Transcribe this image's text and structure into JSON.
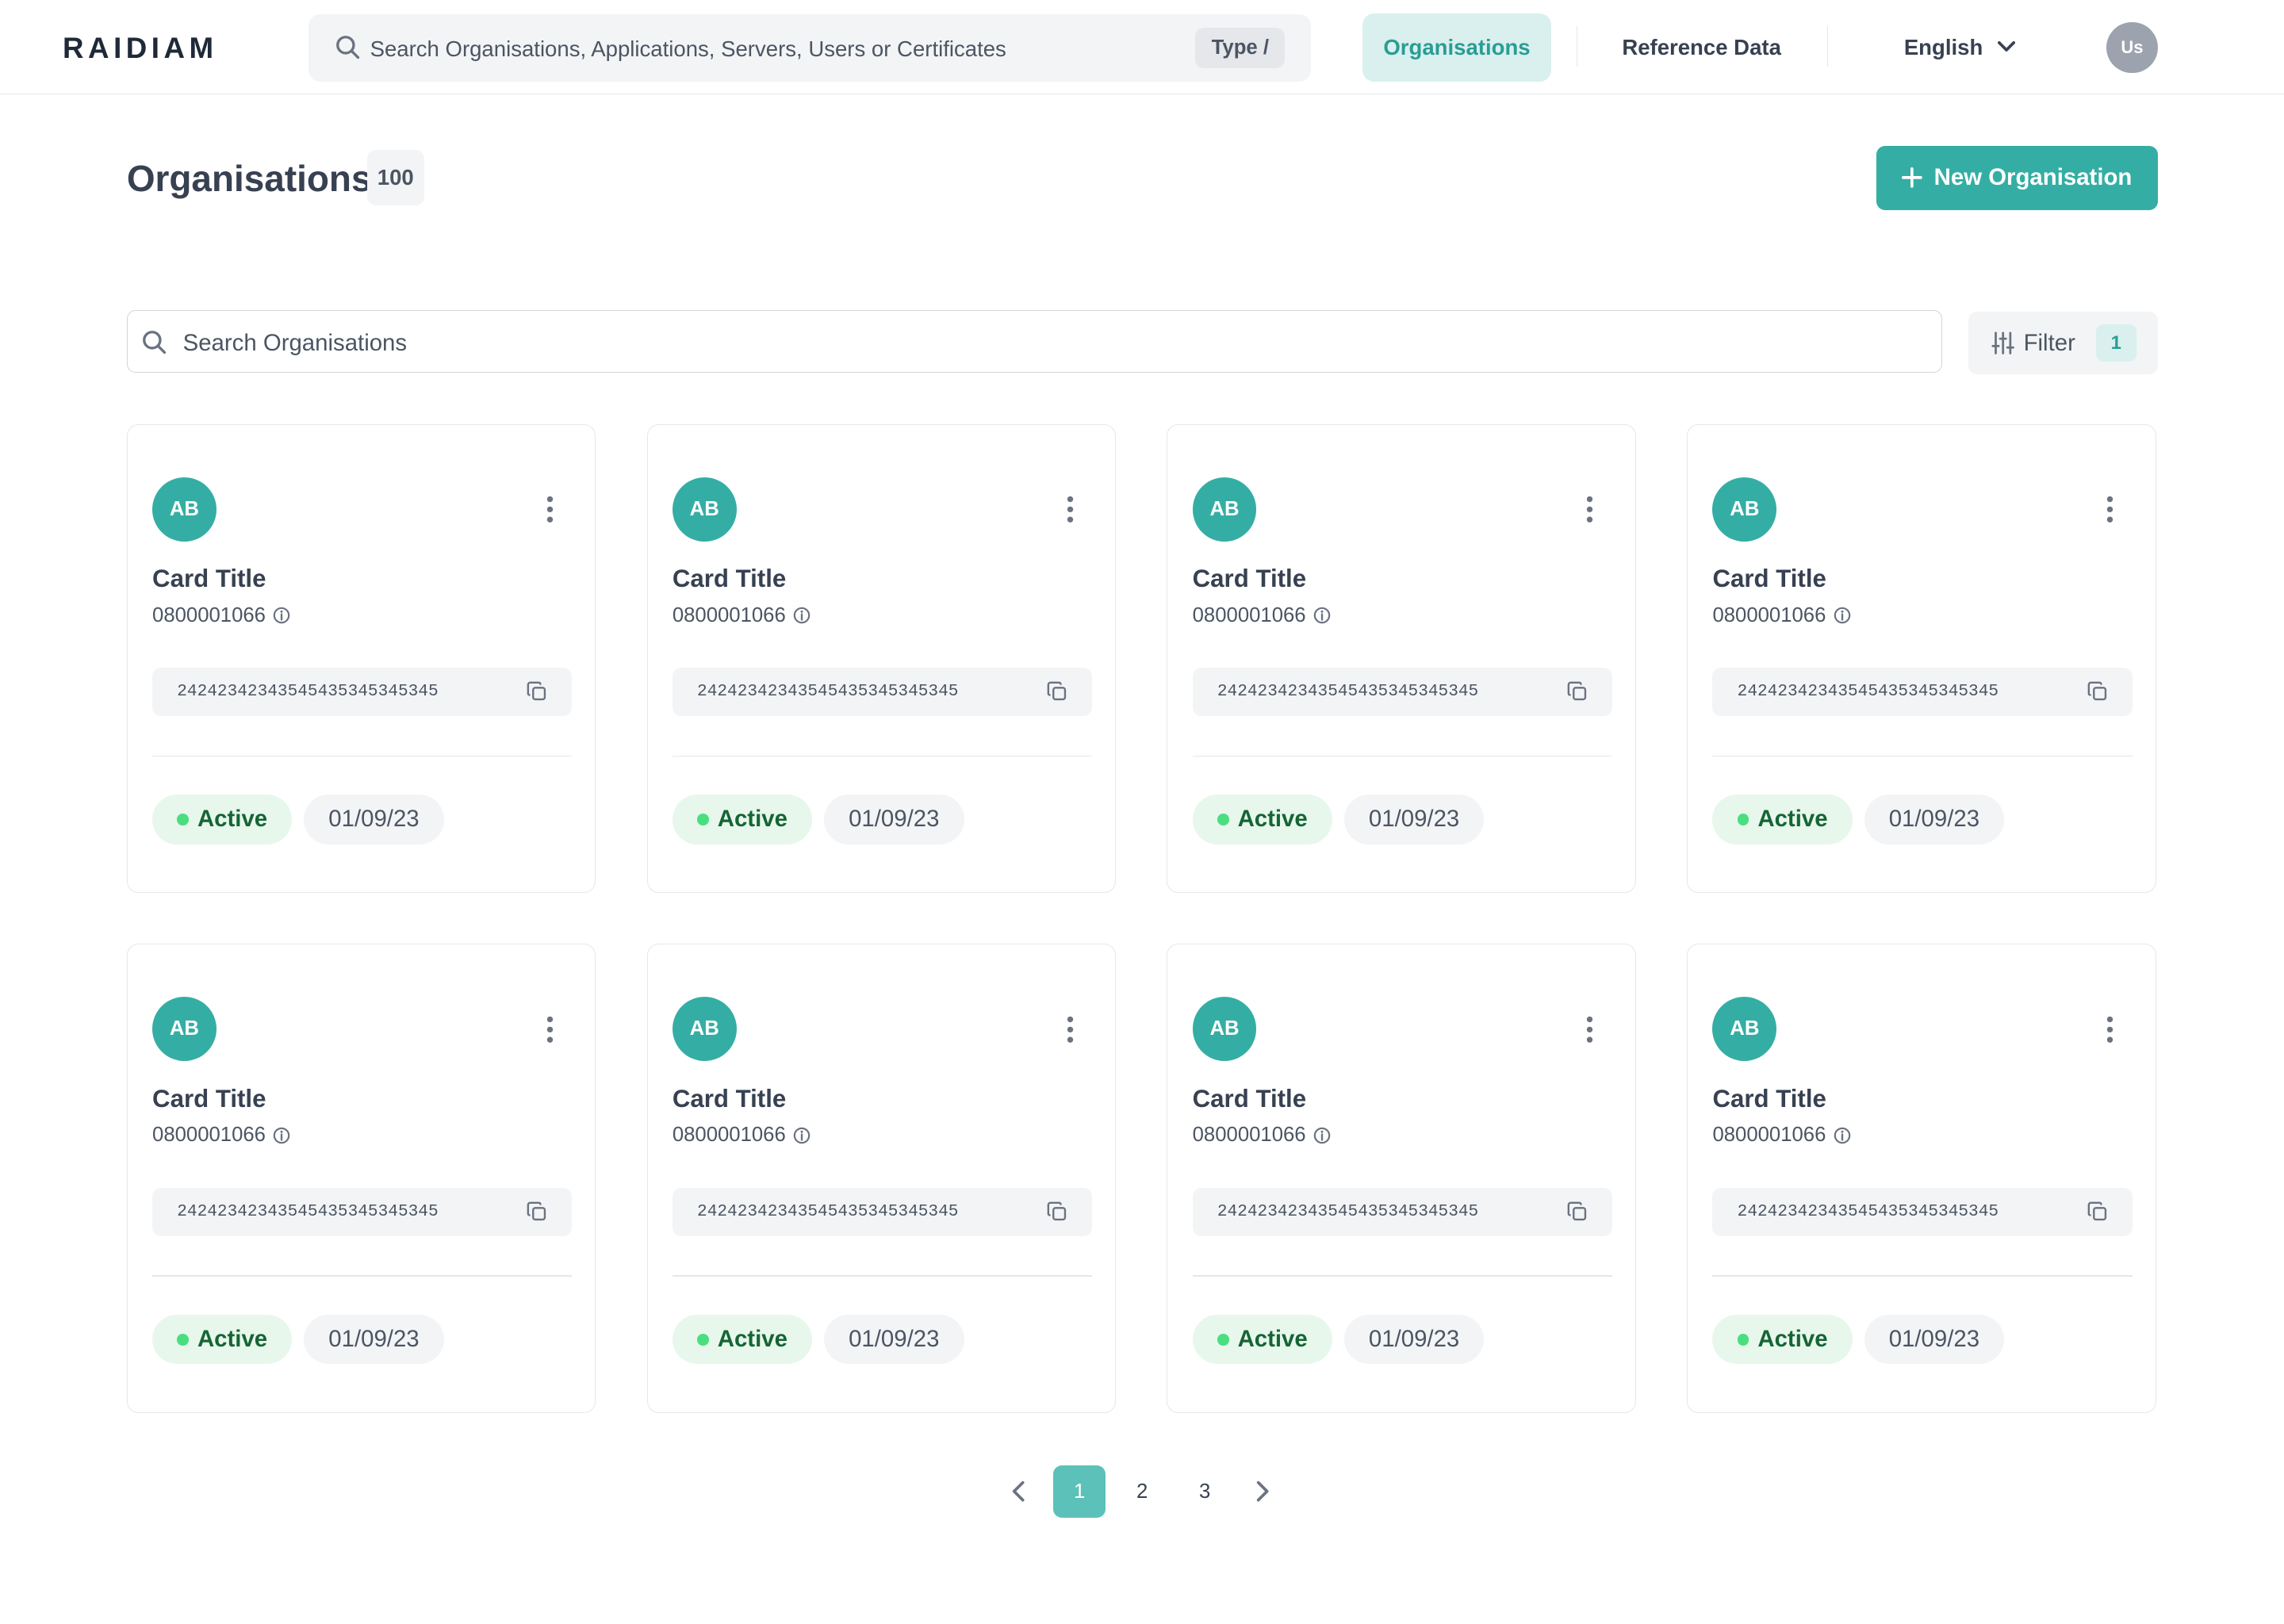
{
  "header": {
    "logo_text": "RAIDIAM",
    "search_placeholder": "Search Organisations, Applications, Servers, Users or Certificates",
    "search_shortcut": "Type /",
    "nav_organisations": "Organisations",
    "nav_reference_data": "Reference Data",
    "language": "English",
    "user_initials": "Us"
  },
  "page": {
    "title": "Organisations",
    "count": "100",
    "new_button": "New Organisation",
    "search_placeholder": "Search Organisations",
    "filter_label": "Filter",
    "filter_count": "1"
  },
  "cards": [
    {
      "initials": "AB",
      "title": "Card Title",
      "id": "0800001066",
      "code": "24242342343545435345345345",
      "status": "Active",
      "date": "01/09/23"
    },
    {
      "initials": "AB",
      "title": "Card Title",
      "id": "0800001066",
      "code": "24242342343545435345345345",
      "status": "Active",
      "date": "01/09/23"
    },
    {
      "initials": "AB",
      "title": "Card Title",
      "id": "0800001066",
      "code": "24242342343545435345345345",
      "status": "Active",
      "date": "01/09/23"
    },
    {
      "initials": "AB",
      "title": "Card Title",
      "id": "0800001066",
      "code": "24242342343545435345345345",
      "status": "Active",
      "date": "01/09/23"
    },
    {
      "initials": "AB",
      "title": "Card Title",
      "id": "0800001066",
      "code": "24242342343545435345345345",
      "status": "Active",
      "date": "01/09/23"
    },
    {
      "initials": "AB",
      "title": "Card Title",
      "id": "0800001066",
      "code": "24242342343545435345345345",
      "status": "Active",
      "date": "01/09/23"
    },
    {
      "initials": "AB",
      "title": "Card Title",
      "id": "0800001066",
      "code": "24242342343545435345345345",
      "status": "Active",
      "date": "01/09/23"
    },
    {
      "initials": "AB",
      "title": "Card Title",
      "id": "0800001066",
      "code": "24242342343545435345345345",
      "status": "Active",
      "date": "01/09/23"
    }
  ],
  "pagination": {
    "pages": [
      "1",
      "2",
      "3"
    ],
    "current": "1"
  },
  "colors": {
    "accent": "#34aea4",
    "accent_light": "#d9f0ee",
    "status_active": "#166534",
    "status_bg": "#e7f7ec"
  },
  "icons": [
    "search-icon",
    "chevron-down-icon",
    "plus-icon",
    "filter-sliders-icon",
    "kebab-menu-icon",
    "info-icon",
    "copy-icon",
    "chevron-left-icon",
    "chevron-right-icon"
  ]
}
